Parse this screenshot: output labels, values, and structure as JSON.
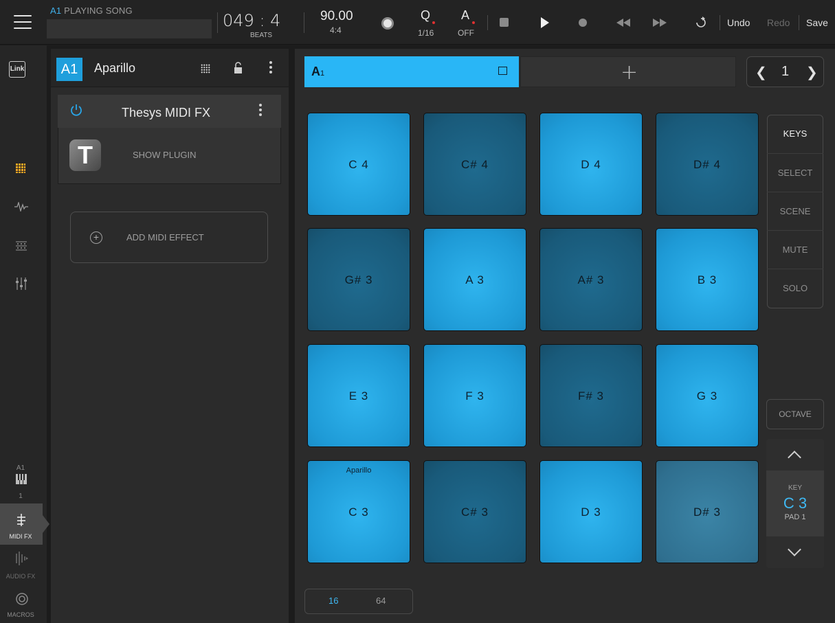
{
  "topbar": {
    "track_tag": "A1",
    "song_status": "PLAYING SONG",
    "position": "049 : 4",
    "position_unit": "BEATS",
    "tempo": "90.00",
    "time_signature": "4:4",
    "quantize_label": "Q",
    "quantize_value": "1/16",
    "automation_label": "A",
    "automation_value": "OFF",
    "undo": "Undo",
    "redo": "Redo",
    "save": "Save"
  },
  "rail": {
    "link": "Link",
    "track_tag": "A1",
    "track_number": "1",
    "midi_fx": "MIDI FX",
    "audio_fx": "AUDIO FX",
    "macros": "MACROS"
  },
  "track": {
    "tag": "A1",
    "name": "Aparillo",
    "fx_name": "Thesys MIDI FX",
    "plugin_logo": "T",
    "show_plugin": "SHOW PLUGIN",
    "add_midi_effect": "ADD MIDI EFFECT"
  },
  "clip": {
    "label": "A",
    "sub": "1",
    "add_symbol": "+",
    "page": "1"
  },
  "pads": [
    {
      "note": "C 4",
      "tone": "light"
    },
    {
      "note": "C# 4",
      "tone": "dark"
    },
    {
      "note": "D 4",
      "tone": "light"
    },
    {
      "note": "D# 4",
      "tone": "dark"
    },
    {
      "note": "G# 3",
      "tone": "dark"
    },
    {
      "note": "A 3",
      "tone": "light"
    },
    {
      "note": "A# 3",
      "tone": "dark"
    },
    {
      "note": "B 3",
      "tone": "light"
    },
    {
      "note": "E 3",
      "tone": "light"
    },
    {
      "note": "F 3",
      "tone": "light"
    },
    {
      "note": "F# 3",
      "tone": "dark"
    },
    {
      "note": "G 3",
      "tone": "light"
    },
    {
      "note": "C 3",
      "tone": "light",
      "name": "Aparillo"
    },
    {
      "note": "C# 3",
      "tone": "dark"
    },
    {
      "note": "D 3",
      "tone": "light"
    },
    {
      "note": "D# 3",
      "tone": "muted"
    }
  ],
  "modes": [
    "KEYS",
    "SELECT",
    "SCENE",
    "MUTE",
    "SOLO"
  ],
  "octave": "OCTAVE",
  "key": {
    "label": "KEY",
    "value": "C 3",
    "pad": "PAD 1"
  },
  "grid_size": {
    "options": [
      "16",
      "64"
    ],
    "selected": "16"
  },
  "colors": {
    "accent": "#29b6f6",
    "pad_light": "#1e9ad6",
    "pad_dark": "#195a7a",
    "record_dot": "#e03030"
  }
}
